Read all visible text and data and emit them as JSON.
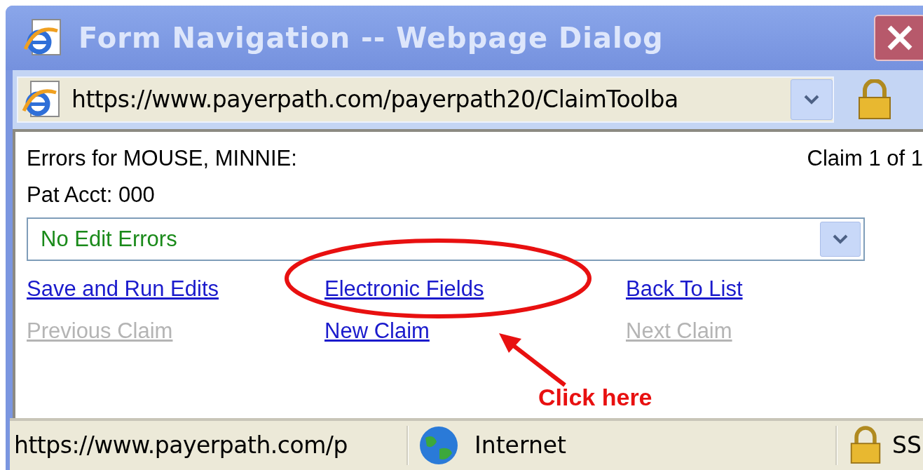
{
  "window": {
    "title": "Form Navigation -- Webpage Dialog"
  },
  "address_bar": {
    "url": "https://www.payerpath.com/payerpath20/ClaimToolba"
  },
  "header": {
    "errors_for": "Errors for MOUSE, MINNIE:",
    "claim_counter": "Claim 1 of 1",
    "pat_acct": "Pat Acct: 000"
  },
  "errors_dropdown": {
    "value": "No Edit Errors"
  },
  "links": [
    {
      "label": "Save and Run Edits",
      "disabled": false
    },
    {
      "label": "Electronic Fields",
      "disabled": false
    },
    {
      "label": "Back To List",
      "disabled": false
    },
    {
      "label": "Previous Claim",
      "disabled": true
    },
    {
      "label": "New Claim",
      "disabled": false
    },
    {
      "label": "Next Claim",
      "disabled": true
    }
  ],
  "annotation": {
    "label": "Click here"
  },
  "status_bar": {
    "url": "https://www.payerpath.com/p",
    "zone": "Internet",
    "security": "SS"
  }
}
